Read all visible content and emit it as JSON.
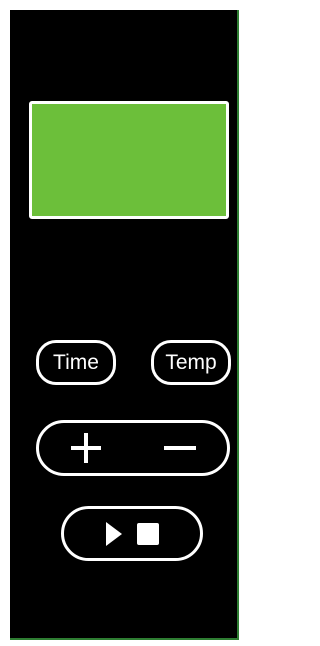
{
  "controls": {
    "time_label": "Time",
    "temp_label": "Temp"
  },
  "icons": {
    "plus": "plus-icon",
    "minus": "minus-icon",
    "play": "play-icon",
    "stop": "stop-icon"
  },
  "colors": {
    "panel": "#000000",
    "display": "#6cbf3a",
    "outline": "#ffffff",
    "panel_edge": "#2e7d32"
  }
}
